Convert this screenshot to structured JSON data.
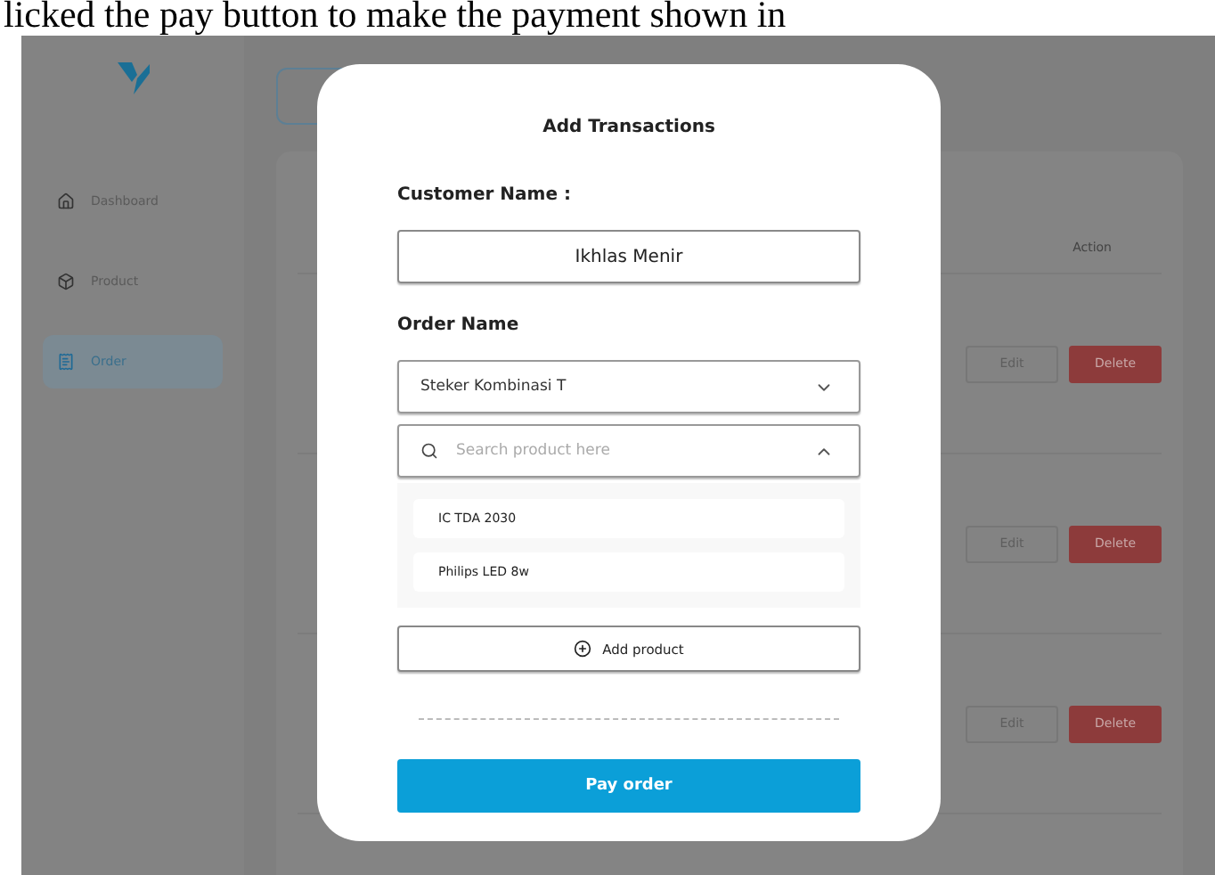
{
  "caption": "licked the pay button to make the payment shown in",
  "sidebar": {
    "items": [
      {
        "label": "Dashboard",
        "selected": false
      },
      {
        "label": "Product",
        "selected": false
      },
      {
        "label": "Order",
        "selected": true
      }
    ]
  },
  "table": {
    "columns": [
      {
        "label": "Action"
      }
    ],
    "rows": [
      {
        "actions": [
          "Edit",
          "Delete"
        ]
      },
      {
        "actions": [
          "Edit",
          "Delete"
        ]
      },
      {
        "actions": [
          "Edit",
          "Delete"
        ]
      }
    ]
  },
  "modal": {
    "title": "Add Transactions",
    "customer_label": "Customer Name :",
    "customer_value": "Ikhlas Menir",
    "order_label": "Order Name",
    "order_value": "Steker Kombinasi T",
    "search": {
      "placeholder": "Search product here",
      "expanded": true
    },
    "results": [
      "IC TDA 2030",
      "Philips LED 8w"
    ],
    "add_button": "Add product",
    "pay_button": "Pay order"
  }
}
